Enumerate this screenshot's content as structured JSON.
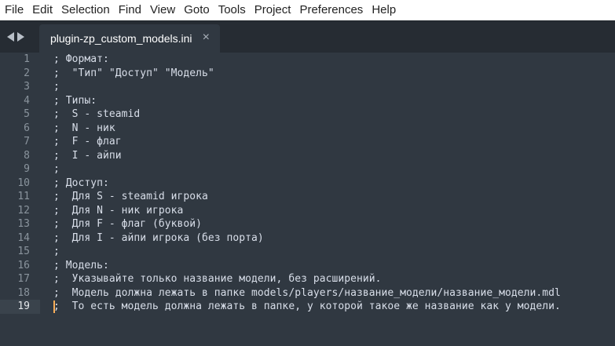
{
  "menu": {
    "items": [
      "File",
      "Edit",
      "Selection",
      "Find",
      "View",
      "Goto",
      "Tools",
      "Project",
      "Preferences",
      "Help"
    ]
  },
  "tab": {
    "title": "plugin-zp_custom_models.ini",
    "close_glyph": "×"
  },
  "editor": {
    "active_line": 19,
    "lines": [
      "; Формат:",
      ";  \"Тип\" \"Доступ\" \"Модель\"",
      ";",
      "; Типы:",
      ";  S - steamid",
      ";  N - ник",
      ";  F - флаг",
      ";  I - айпи",
      ";",
      "; Доступ:",
      ";  Для S - steamid игрока",
      ";  Для N - ник игрока",
      ";  Для F - флаг (буквой)",
      ";  Для I - айпи игрока (без порта)",
      ";",
      "; Модель:",
      ";  Указывайте только название модели, без расширений.",
      ";  Модель должна лежать в папке models/players/название_модели/название_модели.mdl",
      ";  То есть модель должна лежать в папке, у которой такое же название как у модели."
    ]
  },
  "colors": {
    "background": "#303841",
    "tabbar": "#262c33",
    "text": "#d8dee9",
    "gutter_text": "#8a949d"
  }
}
